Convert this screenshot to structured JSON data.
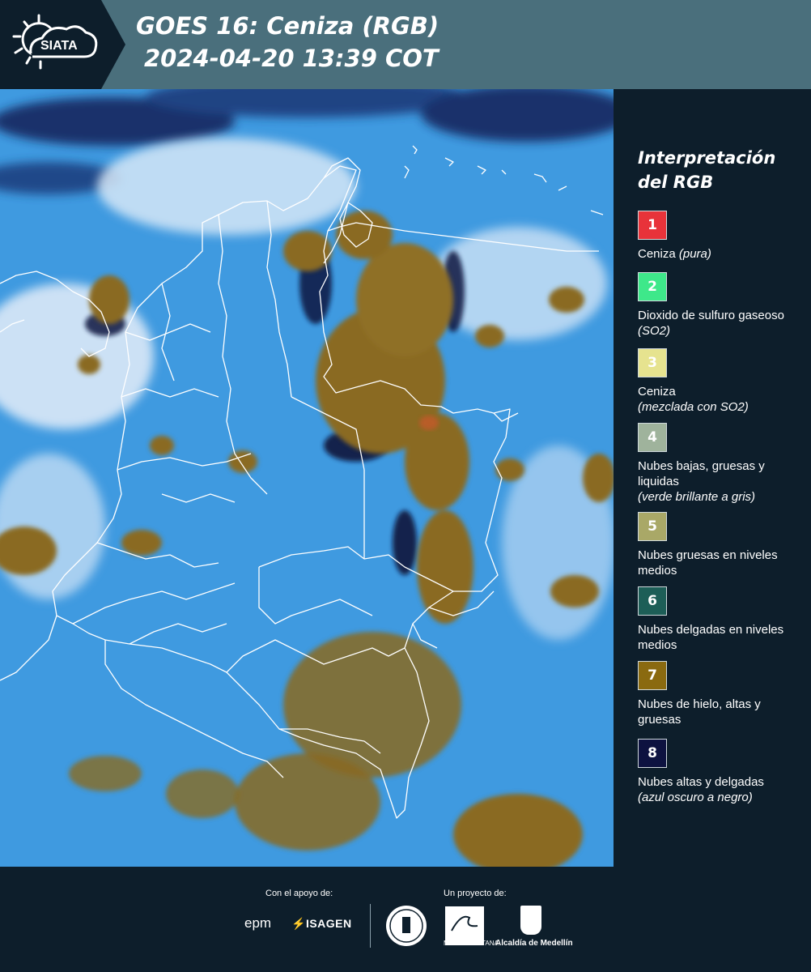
{
  "header": {
    "logo_text": "SIATA",
    "title_line1": "GOES 16: Ceniza (RGB)",
    "title_line2": "2024-04-20 13:39 COT"
  },
  "legend": {
    "title": "Interpretación del RGB",
    "items": [
      {
        "number": "1",
        "label": "Ceniza",
        "note": "(pura)",
        "color": "#e8333a"
      },
      {
        "number": "2",
        "label": "Dioxido de sulfuro gaseoso",
        "note": "(SO2)",
        "color": "#3ee88a"
      },
      {
        "number": "3",
        "label": "Ceniza",
        "note": "(mezclada con SO2)",
        "color": "#e6e38f"
      },
      {
        "number": "4",
        "label": "Nubes bajas, gruesas y liquidas",
        "note": "(verde brillante a gris)",
        "color": "#9fb39c"
      },
      {
        "number": "5",
        "label": "Nubes gruesas en niveles medios",
        "note": "",
        "color": "#a9a867"
      },
      {
        "number": "6",
        "label": "Nubes delgadas en niveles medios",
        "note": "",
        "color": "#1d5e57"
      },
      {
        "number": "7",
        "label": "Nubes de hielo, altas y gruesas",
        "note": "",
        "color": "#8a6a10"
      },
      {
        "number": "8",
        "label": "Nubes altas y delgadas",
        "note": "(azul oscuro a negro)",
        "color": "#0d1240"
      }
    ]
  },
  "footer": {
    "support_label": "Con el apoyo de:",
    "project_label": "Un proyecto de:",
    "epm": "epm",
    "isagen": "ISAGEN",
    "area_text": "METROPOLITANA",
    "alcaldia": "Alcaldía de Medellín"
  }
}
